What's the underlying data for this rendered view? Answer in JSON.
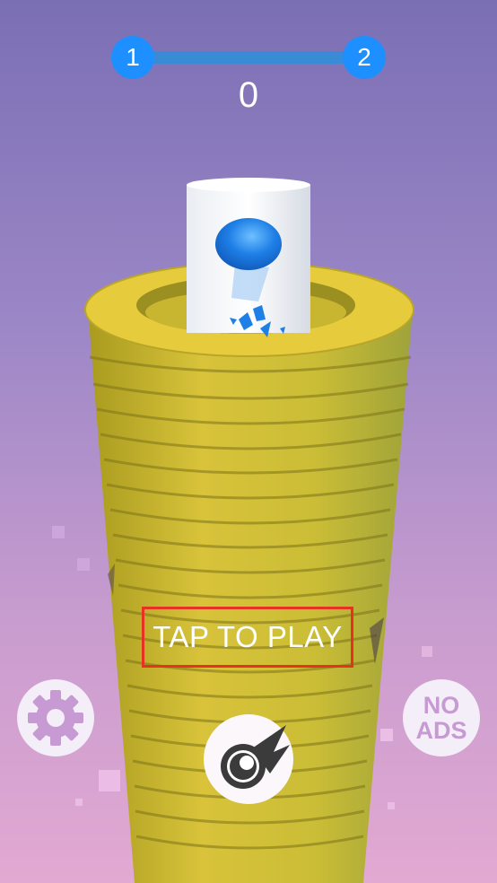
{
  "level": {
    "current": "1",
    "next": "2",
    "progress": 0
  },
  "score": "0",
  "prompt": "TAP TO PLAY",
  "buttons": {
    "settings_icon": "gear-icon",
    "no_ads_line1": "NO",
    "no_ads_line2": "ADS",
    "ball_select_icon": "ball-icon"
  },
  "colors": {
    "tower": "#d8c339",
    "ball": "#1e7fe6",
    "accent_blue": "#1e8fff",
    "highlight": "#e53223"
  }
}
